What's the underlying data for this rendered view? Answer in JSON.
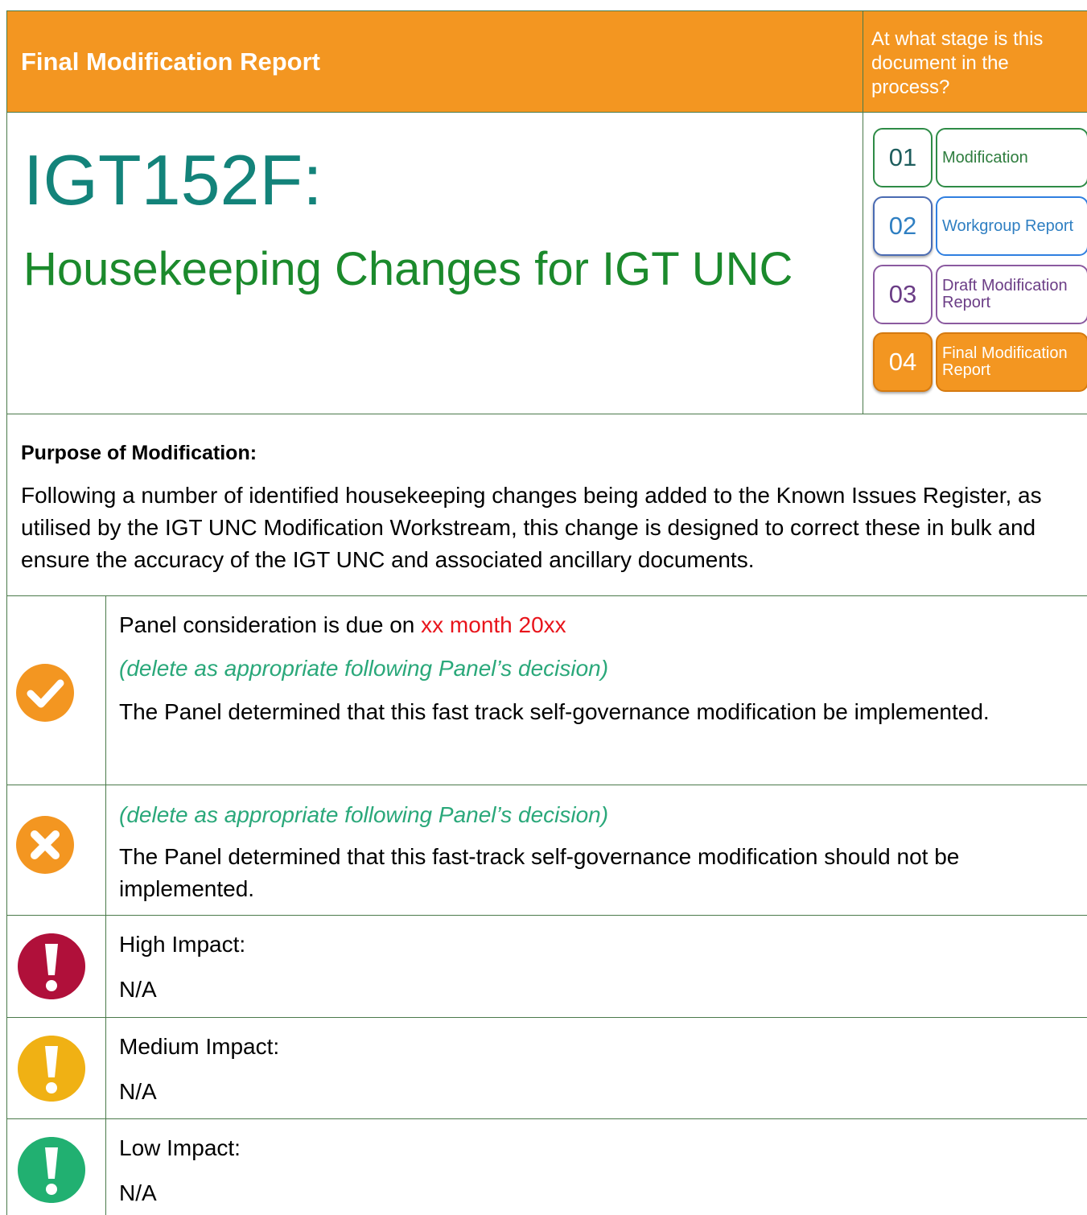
{
  "header": {
    "report_type": "Final Modification Report",
    "stage_question": "At what stage is this document in the process?"
  },
  "modification": {
    "id": "IGT152F:",
    "title": "Housekeeping Changes for IGT UNC"
  },
  "stages": [
    {
      "number": "01",
      "label": "Modification"
    },
    {
      "number": "02",
      "label": "Workgroup Report"
    },
    {
      "number": "03",
      "label": "Draft Modification Report"
    },
    {
      "number": "04",
      "label": "Final Modification Report"
    }
  ],
  "purpose": {
    "heading": "Purpose of Modification:",
    "text": "Following a number of identified housekeeping changes being added to the Known Issues Register, as utilised by the IGT UNC Modification Workstream, this change is designed to correct these in bulk and ensure the accuracy of the IGT UNC and associated ancillary documents."
  },
  "decision_approve": {
    "prefix": "Panel consideration is due on ",
    "date": "xx month 20xx",
    "note": "(delete as appropriate following Panel’s decision)",
    "text": "The Panel determined that this fast track self-governance modification be implemented."
  },
  "decision_reject": {
    "note": "(delete as appropriate following Panel’s decision)",
    "text": "The Panel determined that this fast-track self-governance modification should not be implemented."
  },
  "impacts": [
    {
      "label": "High Impact:",
      "value": "N/A",
      "color": "#b0103a"
    },
    {
      "label": "Medium Impact:",
      "value": "N/A",
      "color": "#f0b114"
    },
    {
      "label": "Low Impact:",
      "value": "N/A",
      "color": "#21b071"
    }
  ],
  "colors": {
    "orange": "#f39621",
    "teal": "#13837a",
    "green": "#1b8a2c"
  }
}
